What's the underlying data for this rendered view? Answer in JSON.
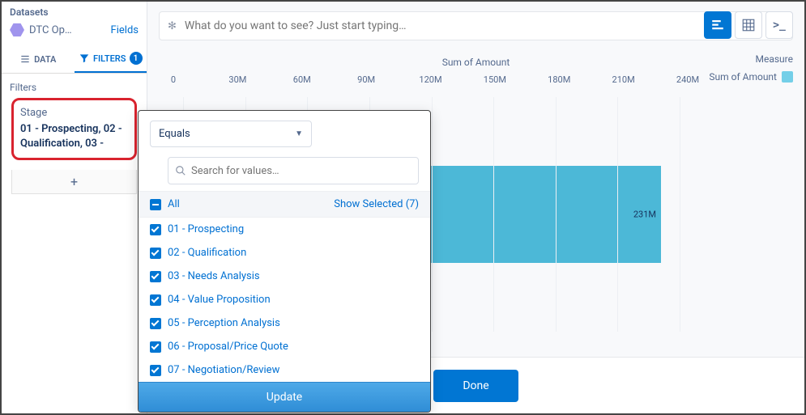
{
  "sidebar": {
    "datasets_label": "Datasets",
    "dataset_name": "DTC Op…",
    "fields_link": "Fields",
    "tabs": {
      "data": "DATA",
      "filters": "FILTERS",
      "filter_count": "1"
    },
    "filters_heading": "Filters",
    "filter_card": {
      "title": "Stage",
      "values": "01 - Prospecting, 02 - Qualification, 03 -"
    },
    "add_label": "+"
  },
  "query": {
    "placeholder": "What do you want to see? Just start typing…"
  },
  "chart_data": {
    "type": "bar",
    "orientation": "horizontal",
    "title": "Sum of Amount",
    "xlabel": "",
    "ylabel": "",
    "xlim": [
      0,
      240
    ],
    "ticks": [
      "0",
      "30M",
      "60M",
      "90M",
      "120M",
      "150M",
      "180M",
      "210M",
      "240M"
    ],
    "series": [
      {
        "name": "Sum of Amount",
        "values": [
          231
        ],
        "value_labels": [
          "231M"
        ]
      }
    ]
  },
  "measure": {
    "heading": "Measure",
    "legend": "Sum of Amount"
  },
  "popover": {
    "operator": "Equals",
    "search_placeholder": "Search for values…",
    "all_label": "All",
    "show_selected": "Show Selected (7)",
    "options": [
      "01 - Prospecting",
      "02 - Qualification",
      "03 - Needs Analysis",
      "04 - Value Proposition",
      "05 - Perception Analysis",
      "06 - Proposal/Price Quote",
      "07 - Negotiation/Review"
    ],
    "update_label": "Update"
  },
  "footer": {
    "done": "Done"
  }
}
